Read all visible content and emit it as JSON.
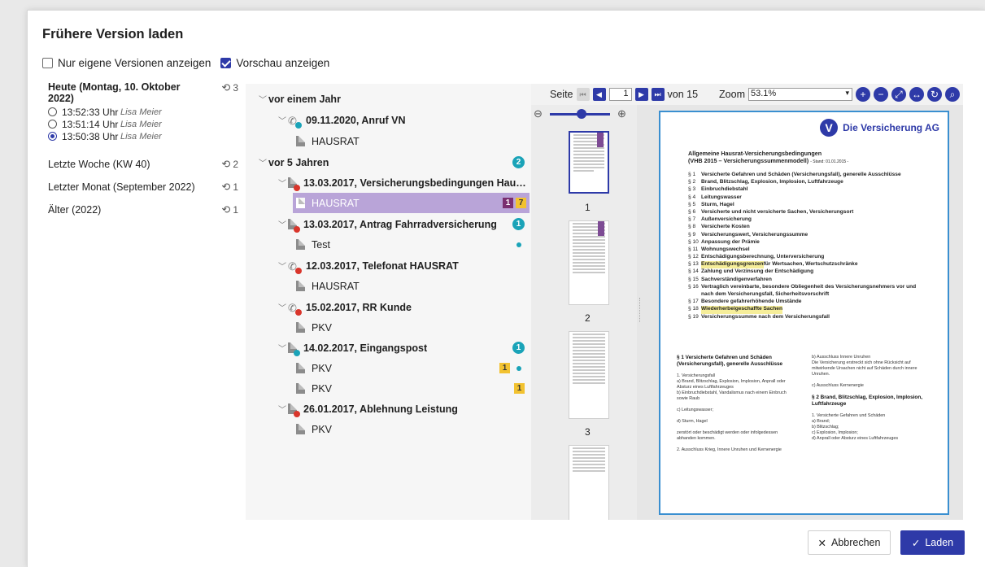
{
  "dialog": {
    "title": "Frühere Version laden",
    "opt_own_label": "Nur eigene Versionen anzeigen",
    "opt_preview_label": "Vorschau anzeigen"
  },
  "versions": {
    "today": {
      "title": "Heute (Montag, 10. Oktober 2022)",
      "count": "3",
      "items": [
        {
          "time": "13:52:33 Uhr",
          "user": "Lisa Meier"
        },
        {
          "time": "13:51:14 Uhr",
          "user": "Lisa Meier"
        },
        {
          "time": "13:50:38 Uhr",
          "user": "Lisa Meier"
        }
      ]
    },
    "groups": [
      {
        "label": "Letzte Woche (KW 40)",
        "count": "2"
      },
      {
        "label": "Letzter Monat (September 2022)",
        "count": "1"
      },
      {
        "label": "Älter (2022)",
        "count": "1"
      }
    ]
  },
  "tree": {
    "sec1": "vor einem Jahr",
    "e1": "09.11.2020, Anruf VN",
    "e1d": "HAUSRAT",
    "sec2": "vor 5 Jahren",
    "sec2_count": "2",
    "e2": "13.03.2017, Versicherungsbedingungen Hau…",
    "e2d": "HAUSRAT",
    "e2d_b1": "1",
    "e2d_b2": "7",
    "e3": "13.03.2017, Antrag Fahrradversicherung",
    "e3_count": "1",
    "e3d": "Test",
    "e4": "12.03.2017, Telefonat HAUSRAT",
    "e4d": "HAUSRAT",
    "e5": "15.02.2017, RR Kunde",
    "e5d": "PKV",
    "e6": "14.02.2017, Eingangspost",
    "e6_count": "1",
    "e6d1": "PKV",
    "e6d1_b": "1",
    "e6d2": "PKV",
    "e6d2_b": "1",
    "e7": "26.01.2017, Ablehnung Leistung",
    "e7d": "PKV"
  },
  "viewer": {
    "page_label": "Seite",
    "page_value": "1",
    "of_label": "von 15",
    "zoom_label": "Zoom",
    "zoom_value": "53.1%",
    "thumbs": [
      "1",
      "2",
      "3"
    ],
    "doc": {
      "company": "Die Versicherung AG",
      "title1": "Allgemeine Hausrat-Versicherungsbedingungen",
      "title2": "(VHB 2015 – Versicherungssummenmodell)",
      "stand": "- Stand: 01.01.2015 -",
      "toc": [
        {
          "n": "§ 1",
          "t": "Versicherte Gefahren und Schäden (Versicherungsfall), generelle Ausschlüsse"
        },
        {
          "n": "§ 2",
          "t": "Brand, Blitzschlag, Explosion, Implosion, Luftfahrzeuge"
        },
        {
          "n": "§ 3",
          "t": "Einbruchdiebstahl"
        },
        {
          "n": "§ 4",
          "t": "Leitungswasser"
        },
        {
          "n": "§ 5",
          "t": "Sturm, Hagel"
        },
        {
          "n": "§ 6",
          "t": "Versicherte und nicht versicherte Sachen, Versicherungsort"
        },
        {
          "n": "§ 7",
          "t": "Außenversicherung"
        },
        {
          "n": "§ 8",
          "t": "Versicherte Kosten"
        },
        {
          "n": "§ 9",
          "t": "Versicherungswert, Versicherungssumme"
        },
        {
          "n": "§ 10",
          "t": "Anpassung der Prämie"
        },
        {
          "n": "§ 11",
          "t": "Wohnungswechsel"
        },
        {
          "n": "§ 12",
          "t": "Entschädigungsberechnung, Unterversicherung"
        },
        {
          "n": "§ 13",
          "t": "Entschädigungsgrenzen",
          "t2": " für Wertsachen, Wertschutzschränke"
        },
        {
          "n": "§ 14",
          "t": "Zahlung und Verzinsung der Entschädigung"
        },
        {
          "n": "§ 15",
          "t": "Sachverständigenverfahren"
        },
        {
          "n": "§ 16",
          "t": "Vertraglich vereinbarte, besondere Obliegenheit des Versicherungsnehmers vor und"
        },
        {
          "n": "",
          "t": "nach dem Versicherungsfall, Sicherheitsvorschrift"
        },
        {
          "n": "§ 17",
          "t": "Besondere gefahrerhöhende Umstände"
        },
        {
          "n": "§ 18",
          "t": "Wiederherbeigeschaffte Sachen"
        },
        {
          "n": "§ 19",
          "t": "Versicherungssumme nach dem Versicherungsfall"
        }
      ],
      "col1_head": "§ 1   Versicherte Gefahren und Schäden (Versicherungsfall), generelle Ausschlüsse",
      "col2_head": "§ 2   Brand, Blitzschlag, Explosion, Implosion, Luftfahrzeuge"
    }
  },
  "footer": {
    "cancel_label": "Abbrechen",
    "load_label": "Laden"
  }
}
